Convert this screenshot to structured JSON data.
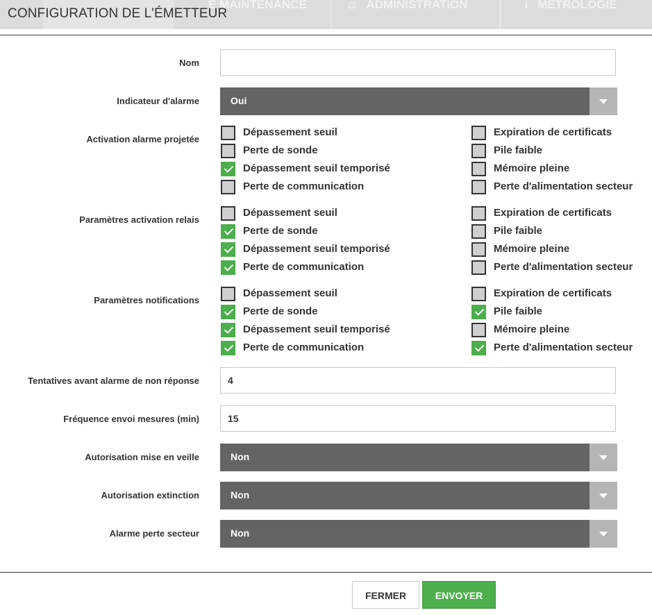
{
  "background_nav": {
    "tabs": [
      {
        "icon": "wrench-icon",
        "label": "E MAINTENANCE"
      },
      {
        "icon": "balance-icon",
        "glyph": "⚖",
        "label": "ADMINISTRATION"
      },
      {
        "icon": "info-icon",
        "glyph": "i",
        "label": "MÉTROLOGIE"
      }
    ]
  },
  "modal": {
    "title": "CONFIGURATION DE L'ÉMETTEUR"
  },
  "form": {
    "nom": {
      "label": "Nom",
      "value": "",
      "placeholder": ""
    },
    "indicateur_alarme": {
      "label": "Indicateur d'alarme",
      "value": "Oui"
    },
    "activation_alarme_projetee": {
      "label": "Activation alarme projetée",
      "options": [
        {
          "label": "Dépassement seuil",
          "checked": false
        },
        {
          "label": "Perte de sonde",
          "checked": false
        },
        {
          "label": "Dépassement seuil temporisé",
          "checked": true
        },
        {
          "label": "Perte de communication",
          "checked": false
        },
        {
          "label": "Expiration de certificats",
          "checked": false
        },
        {
          "label": "Pile faible",
          "checked": false
        },
        {
          "label": "Mémoire pleine",
          "checked": false
        },
        {
          "label": "Perte d'alimentation secteur",
          "checked": false
        }
      ]
    },
    "parametres_activation_relais": {
      "label": "Paramètres activation relais",
      "options": [
        {
          "label": "Dépassement seuil",
          "checked": false
        },
        {
          "label": "Perte de sonde",
          "checked": true
        },
        {
          "label": "Dépassement seuil temporisé",
          "checked": true
        },
        {
          "label": "Perte de communication",
          "checked": true
        },
        {
          "label": "Expiration de certificats",
          "checked": false
        },
        {
          "label": "Pile faible",
          "checked": false
        },
        {
          "label": "Mémoire pleine",
          "checked": false
        },
        {
          "label": "Perte d'alimentation secteur",
          "checked": false
        }
      ]
    },
    "parametres_notifications": {
      "label": "Paramètres notifications",
      "options": [
        {
          "label": "Dépassement seuil",
          "checked": false
        },
        {
          "label": "Perte de sonde",
          "checked": true
        },
        {
          "label": "Dépassement seuil temporisé",
          "checked": true
        },
        {
          "label": "Perte de communication",
          "checked": true
        },
        {
          "label": "Expiration de certificats",
          "checked": false
        },
        {
          "label": "Pile faible",
          "checked": true
        },
        {
          "label": "Mémoire pleine",
          "checked": false
        },
        {
          "label": "Perte d'alimentation secteur",
          "checked": true
        }
      ]
    },
    "tentatives": {
      "label": "Tentatives avant alarme de non réponse",
      "value": "4"
    },
    "frequence": {
      "label": "Fréquence envoi mesures (min)",
      "value": "15"
    },
    "autorisation_veille": {
      "label": "Autorisation mise en veille",
      "value": "Non"
    },
    "autorisation_extinction": {
      "label": "Autorisation extinction",
      "value": "Non"
    },
    "alarme_perte_secteur": {
      "label": "Alarme perte secteur",
      "value": "Non"
    }
  },
  "footer": {
    "close_label": "FERMER",
    "send_label": "ENVOYER"
  },
  "colors": {
    "checked": "#4cae4c",
    "select_bg": "#646464",
    "select_arrow_bg": "#b5b5b5",
    "send_button": "#4cae4c"
  }
}
